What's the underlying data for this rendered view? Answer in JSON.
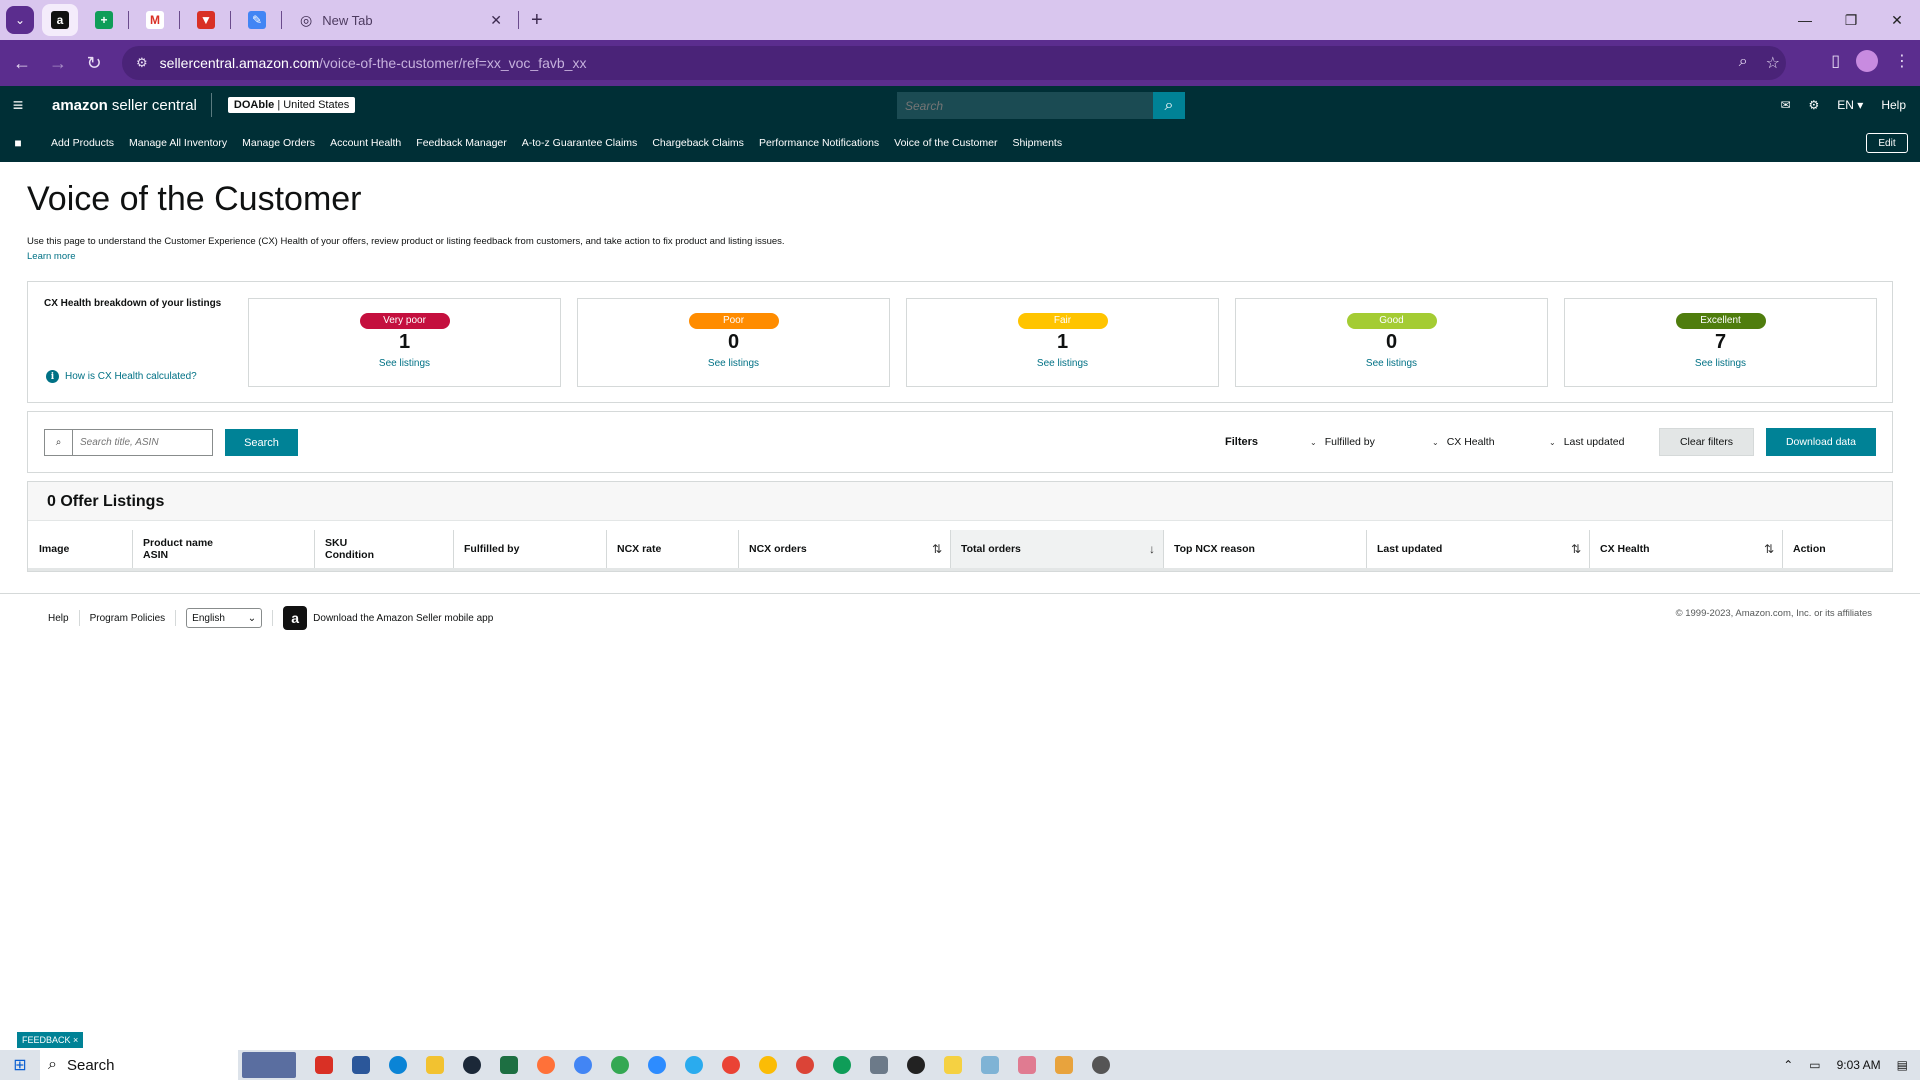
{
  "browser": {
    "tab_title": "New Tab",
    "url_host": "sellercentral.amazon.com",
    "url_path": "/voice-of-the-customer/ref=xx_voc_favb_xx"
  },
  "header": {
    "logo_bold": "amazon",
    "logo_rest": "seller central",
    "store_name": "DOAble",
    "store_region": "| United States",
    "search_placeholder": "Search",
    "lang": "EN",
    "help": "Help"
  },
  "nav": {
    "links": [
      "Add Products",
      "Manage All Inventory",
      "Manage Orders",
      "Account Health",
      "Feedback Manager",
      "A-to-z Guarantee Claims",
      "Chargeback Claims",
      "Performance Notifications",
      "Voice of the Customer",
      "Shipments"
    ],
    "edit": "Edit"
  },
  "page": {
    "title": "Voice of the Customer",
    "description": "Use this page to understand the Customer Experience (CX) Health of your offers, review product or listing feedback from customers, and take action to fix product and listing issues.",
    "learn_more": "Learn more"
  },
  "cx_health": {
    "title": "CX Health breakdown of your listings",
    "help_link": "How is CX Health calculated?",
    "see_listings": "See listings",
    "buckets": [
      {
        "label": "Very poor",
        "count": "1",
        "bg": "#c40f3e",
        "fg": "#ffffff"
      },
      {
        "label": "Poor",
        "count": "0",
        "bg": "#ff8c00",
        "fg": "#ffffff"
      },
      {
        "label": "Fair",
        "count": "1",
        "bg": "#ffc400",
        "fg": "#ffffff"
      },
      {
        "label": "Good",
        "count": "0",
        "bg": "#a4cc33",
        "fg": "#ffffff"
      },
      {
        "label": "Excellent",
        "count": "7",
        "bg": "#4f7d0d",
        "fg": "#ffffff"
      }
    ]
  },
  "filters": {
    "search_placeholder": "Search title, ASIN",
    "search_button": "Search",
    "label": "Filters",
    "fulfilled_by": "Fulfilled by",
    "cx_health": "CX Health",
    "last_updated": "Last updated",
    "clear": "Clear filters",
    "download": "Download data"
  },
  "table": {
    "title": "0 Offer Listings",
    "columns": {
      "image": "Image",
      "product_name": "Product name",
      "asin": "ASIN",
      "sku": "SKU",
      "condition": "Condition",
      "fulfilled_by": "Fulfilled by",
      "ncx_rate": "NCX rate",
      "ncx_orders": "NCX orders",
      "total_orders": "Total orders",
      "top_ncx_reason": "Top NCX reason",
      "last_updated": "Last updated",
      "cx_health": "CX Health",
      "action": "Action"
    }
  },
  "footer": {
    "help": "Help",
    "policies": "Program Policies",
    "language": "English",
    "app_text": "Download the Amazon Seller mobile app",
    "copyright": "© 1999-2023, Amazon.com, Inc. or its affiliates",
    "feedback": "FEEDBACK ×"
  },
  "taskbar": {
    "search": "Search",
    "time": "9:03 AM"
  }
}
